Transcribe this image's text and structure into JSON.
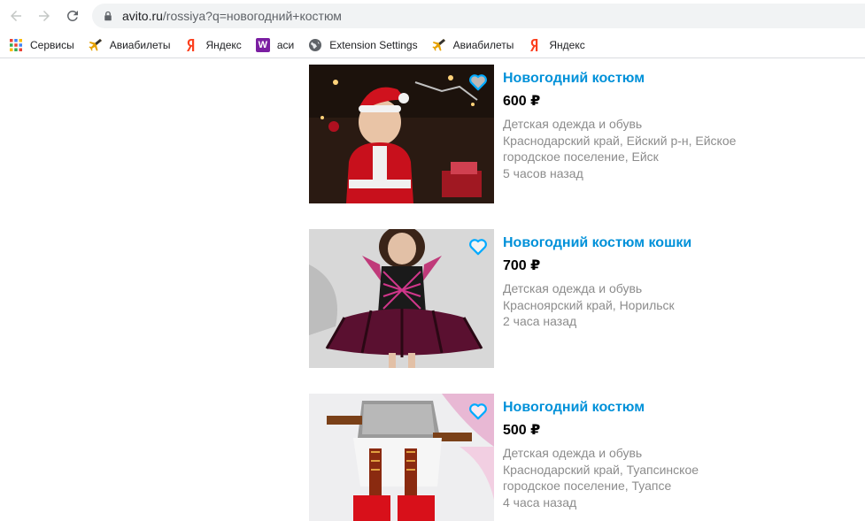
{
  "browser": {
    "url_host": "avito.ru",
    "url_path": "/rossiya?q=новогодний+костюм"
  },
  "bookmarks": [
    {
      "label": "Сервисы",
      "icon": "apps-grid-icon"
    },
    {
      "label": "Авиабилеты",
      "icon": "airplane-icon"
    },
    {
      "label": "Яндекс",
      "icon": "yandex-icon"
    },
    {
      "label": "аси",
      "icon": "w-icon",
      "icon_glyph": "W"
    },
    {
      "label": "Extension Settings",
      "icon": "globe-icon"
    },
    {
      "label": "Авиабилеты",
      "icon": "airplane-icon"
    },
    {
      "label": "Яндекс",
      "icon": "yandex-icon"
    }
  ],
  "listings": [
    {
      "title": "Новогодний костюм",
      "price": "600 ₽",
      "category": "Детская одежда и обувь",
      "location_lines": [
        "Краснодарский край, Ейский р-н, Ейское",
        "городское поселение, Ейск"
      ],
      "time": "5 часов назад"
    },
    {
      "title": "Новогодний костюм кошки",
      "price": "700 ₽",
      "category": "Детская одежда и обувь",
      "location_lines": [
        "Красноярский край, Норильск"
      ],
      "time": "2 часа назад"
    },
    {
      "title": "Новогодний костюм",
      "price": "500 ₽",
      "category": "Детская одежда и обувь",
      "location_lines": [
        "Краснодарский край, Туапсинское",
        "городское поселение, Туапсе"
      ],
      "time": "4 часа назад"
    }
  ],
  "colors": {
    "link": "#0091d9",
    "meta": "#8c8c8c",
    "favorite": "#0af"
  }
}
